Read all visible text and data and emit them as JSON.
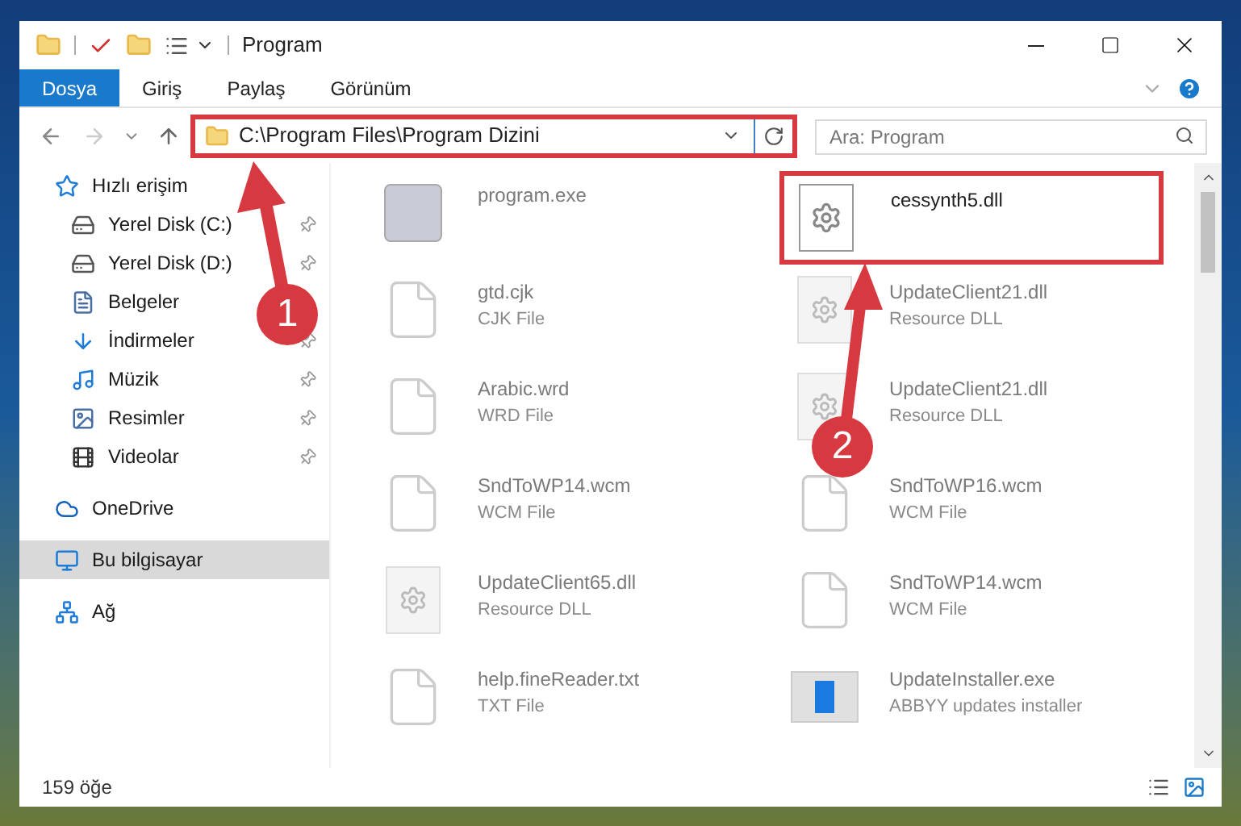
{
  "window": {
    "title": "Program"
  },
  "ribbon_tabs": [
    {
      "label": "Dosya",
      "selected": true
    },
    {
      "label": "Giriş",
      "selected": false
    },
    {
      "label": "Paylaş",
      "selected": false
    },
    {
      "label": "Görünüm",
      "selected": false
    }
  ],
  "address": {
    "path": "C:\\Program Files\\Program Dizini",
    "highlighted": true
  },
  "search": {
    "placeholder": "Ara: Program"
  },
  "sidebar": {
    "items": [
      {
        "label": "Hızlı erişim",
        "kind": "quick",
        "selected": false,
        "children": [
          {
            "label": "Yerel Disk (C:)",
            "kind": "disk-c",
            "pinned": true
          },
          {
            "label": "Yerel Disk (D:)",
            "kind": "disk",
            "pinned": true
          },
          {
            "label": "Belgeler",
            "kind": "docs",
            "pinned": false
          },
          {
            "label": "İndirmeler",
            "kind": "downloads",
            "pinned": true
          },
          {
            "label": "Müzik",
            "kind": "music",
            "pinned": true
          },
          {
            "label": "Resimler",
            "kind": "pictures",
            "pinned": true
          },
          {
            "label": "Videolar",
            "kind": "videos",
            "pinned": true
          }
        ]
      },
      {
        "label": "OneDrive",
        "kind": "cloud",
        "selected": false
      },
      {
        "label": "Bu bilgisayar",
        "kind": "pc",
        "selected": true
      },
      {
        "label": "Ağ",
        "kind": "network",
        "selected": false
      }
    ]
  },
  "files": [
    {
      "name": "program.exe",
      "kind": "exe",
      "faded": true,
      "highlighted": false
    },
    {
      "name": "cessynth5.dll",
      "kind": "dll",
      "faded": false,
      "highlighted": true
    },
    {
      "name": "gtd.cjk",
      "type": "CJK File",
      "kind": "doc",
      "faded": true,
      "highlighted": false
    },
    {
      "name": "UpdateClient21.dll",
      "type": "Resource DLL",
      "kind": "resource",
      "faded": true,
      "highlighted": false
    },
    {
      "name": "Arabic.wrd",
      "type": "WRD File",
      "kind": "doc",
      "faded": true,
      "highlighted": false
    },
    {
      "name": "UpdateClient21.dll",
      "type": "Resource DLL",
      "kind": "resource",
      "faded": true,
      "highlighted": false
    },
    {
      "name": "SndToWP14.wcm",
      "type": "WCM File",
      "kind": "doc",
      "faded": true,
      "highlighted": false
    },
    {
      "name": "SndToWP16.wcm",
      "type": "WCM File",
      "kind": "doc",
      "faded": true,
      "highlighted": false
    },
    {
      "name": "UpdateClient65.dll",
      "type": "Resource DLL",
      "kind": "resource",
      "faded": true,
      "highlighted": false
    },
    {
      "name": "SndToWP14.wcm",
      "type": "WCM File",
      "kind": "doc",
      "faded": true,
      "highlighted": false
    },
    {
      "name": "help.fineReader.txt",
      "type": "TXT File",
      "kind": "doc",
      "faded": true,
      "highlighted": false
    },
    {
      "name": "UpdateInstaller.exe",
      "type": "ABBYY updates installer",
      "kind": "installer",
      "faded": true,
      "highlighted": false
    }
  ],
  "annotations": [
    {
      "label": "1"
    },
    {
      "label": "2"
    }
  ],
  "status_bar": {
    "item_count": "159 öğe"
  }
}
